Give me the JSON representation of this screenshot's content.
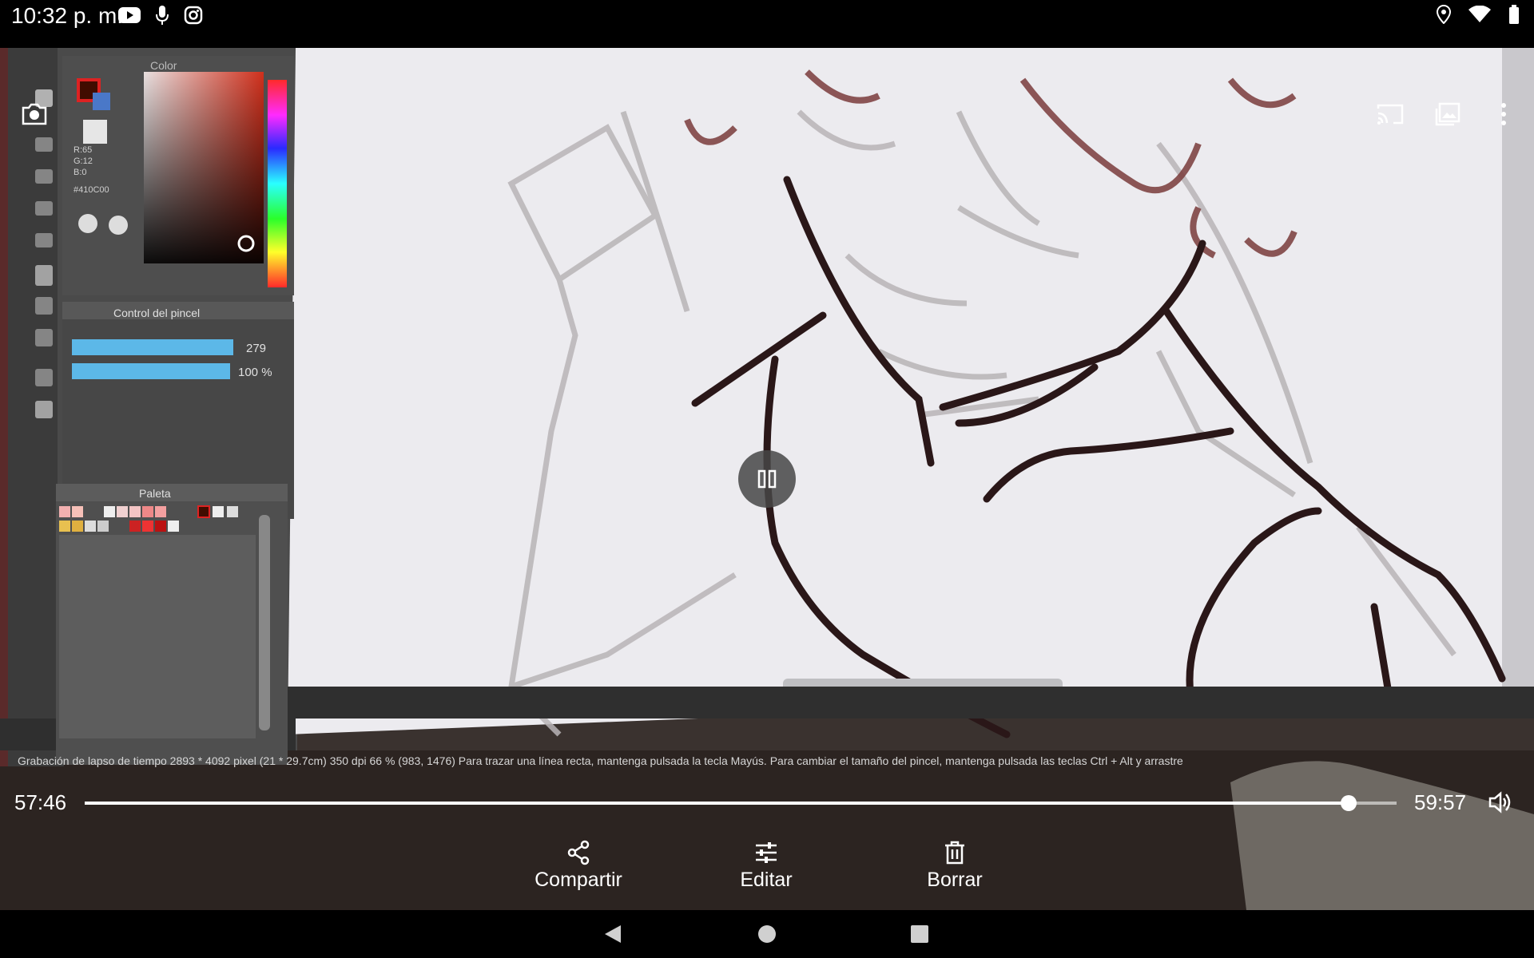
{
  "status_bar": {
    "time": "10:32 p. m.",
    "left_icons": [
      "youtube-icon",
      "mic-icon",
      "instagram-icon"
    ],
    "right_icons": [
      "location-icon",
      "wifi-icon",
      "battery-icon"
    ]
  },
  "top_actions": {
    "icons": [
      "camera-icon",
      "cast-icon",
      "gallery-icon",
      "more-vert-icon"
    ]
  },
  "video_content": {
    "color_panel_title": "Color",
    "brush_panel_title": "Control del pincel",
    "brush_size": "279",
    "brush_opacity": "100 %",
    "palette_title": "Paleta",
    "color_values": [
      "R:65",
      "G:12",
      "B:0",
      "#410C00"
    ],
    "status_text": "Grabación de lapso de tiempo   2893 * 4092 pixel   (21 * 29.7cm)   350 dpi   66 %   (983, 1476)   Para trazar una línea recta, mantenga pulsada la tecla Mayús. Para cambiar el tamaño del pincel, mantenga pulsada las teclas Ctrl + Alt y arrastre"
  },
  "player": {
    "current_time": "57:46",
    "total_time": "59:57",
    "progress": 0.9635,
    "state": "playing"
  },
  "actions": [
    {
      "label": "Compartir",
      "icon": "share-icon"
    },
    {
      "label": "Editar",
      "icon": "tune-icon"
    },
    {
      "label": "Borrar",
      "icon": "trash-icon"
    }
  ],
  "navigation": {
    "icons": [
      "back-icon",
      "home-icon",
      "recents-icon"
    ]
  }
}
